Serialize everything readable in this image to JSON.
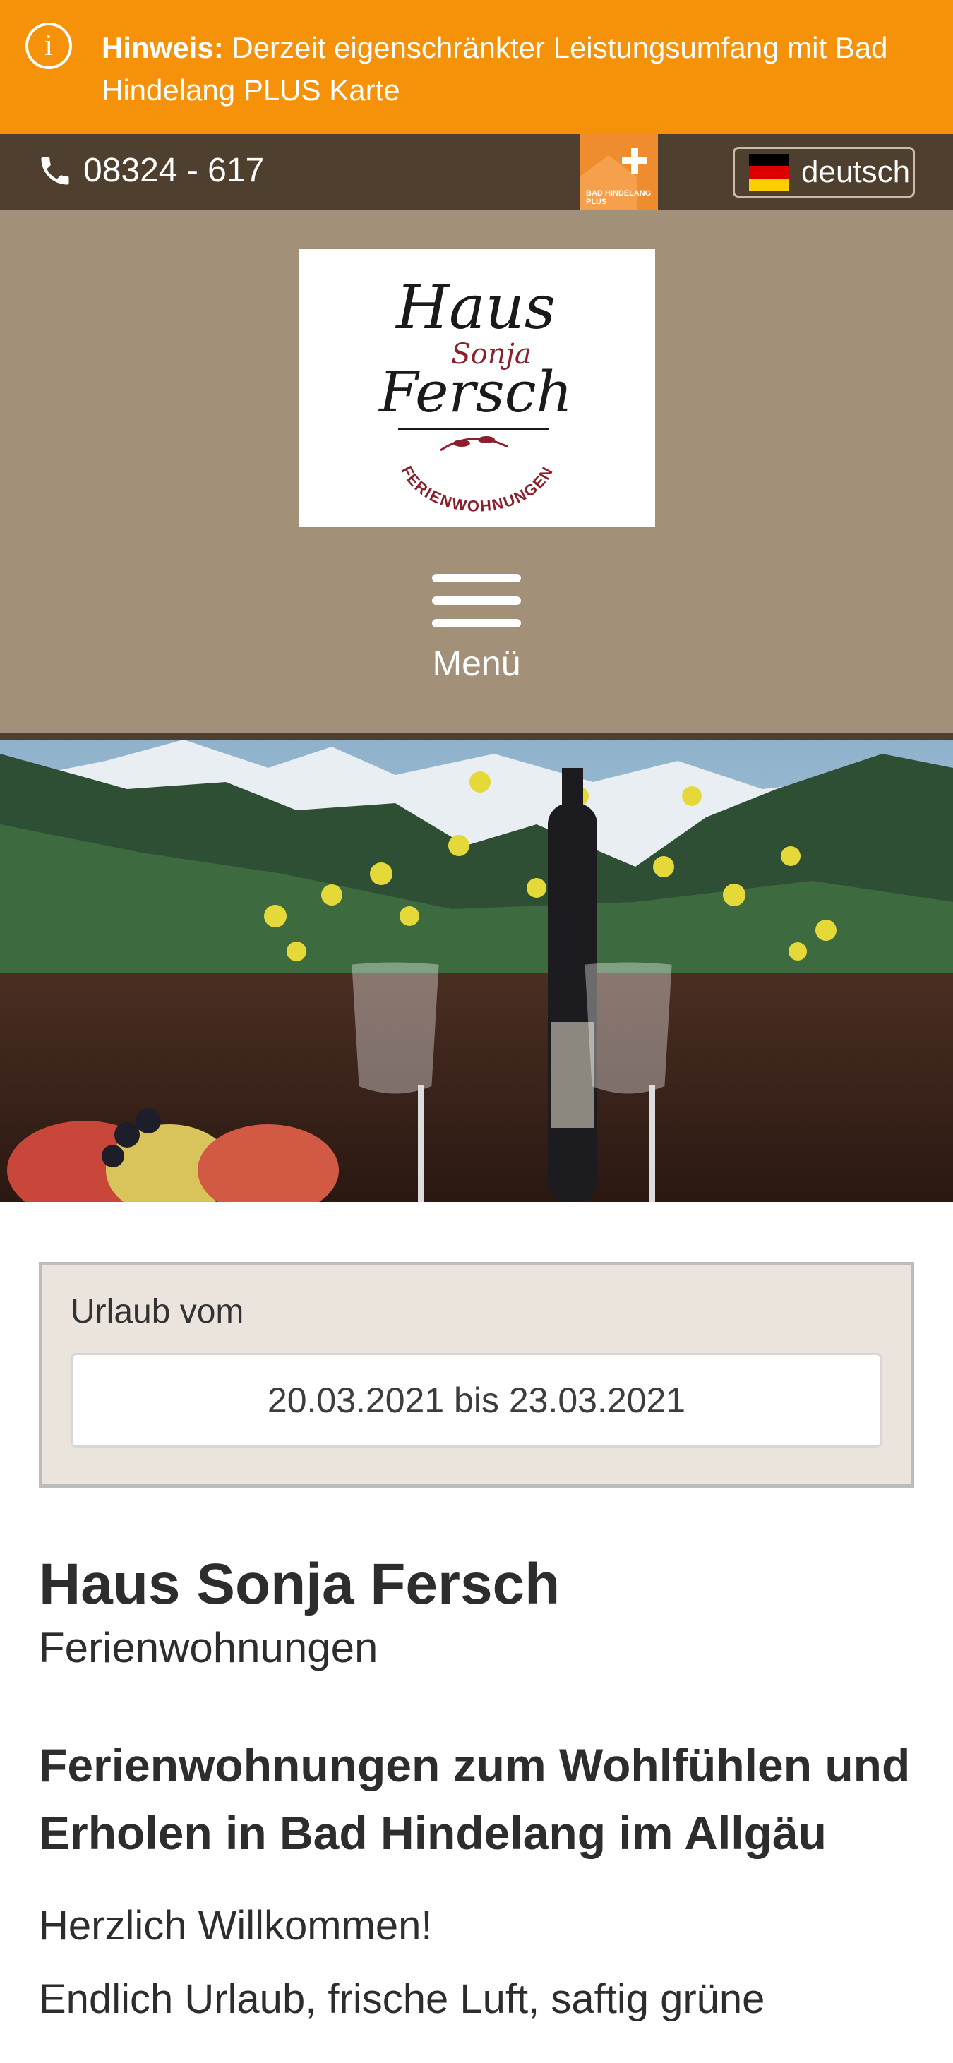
{
  "notice": {
    "icon": "info-icon",
    "label": "Hinweis:",
    "text": " Derzeit eigenschränkter Leistungsumfang mit Bad Hindelang PLUS Karte"
  },
  "topbar": {
    "phone_icon": "phone-icon",
    "phone": "08324 - 617",
    "plus_badge_text": "BAD HINDELANG PLUS",
    "language": "deutsch",
    "flag_icon": "german-flag-icon"
  },
  "logo": {
    "line1": "Haus",
    "line2": "Sonja",
    "line3": "Fersch",
    "line4": "FERIENWOHNUNGEN"
  },
  "menu": {
    "label": "Menü",
    "icon": "hamburger-icon"
  },
  "booking": {
    "label": "Urlaub vom",
    "date_range": "20.03.2021 bis 23.03.2021"
  },
  "content": {
    "title": "Haus Sonja Fersch",
    "subtitle": "Ferienwohnungen",
    "heading": "Ferienwohnungen zum Wohlfühlen und Erholen in Bad Hindelang im Allgäu",
    "welcome": "Herzlich Willkommen!",
    "intro": "Endlich Urlaub, frische Luft, saftig grüne"
  },
  "colors": {
    "notice_bg": "#f6920a",
    "topbar_bg": "#4f3f2e",
    "header_bg": "#a29079",
    "booking_bg": "#ebe4dd",
    "logo_red": "#8b1f2c"
  }
}
